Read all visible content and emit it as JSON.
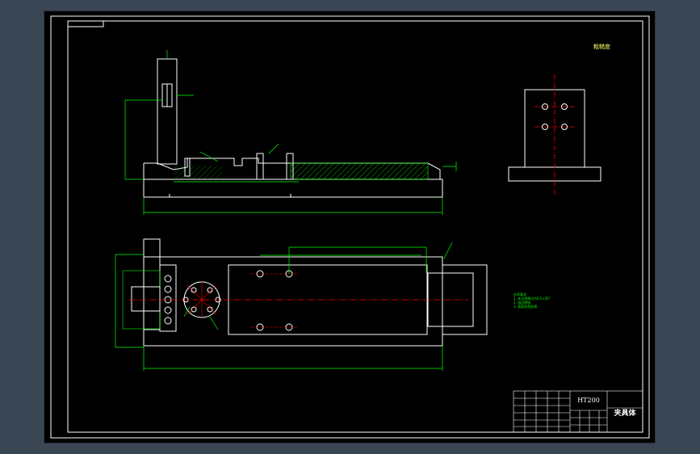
{
  "drawing": {
    "corner_note": "粗糙度",
    "tech_requirements": {
      "title": "技术要求",
      "lines": [
        "1. 未注倒角均为0.5×45°",
        "2. 锐边倒钝",
        "3. 表面发黑处理"
      ]
    },
    "title_block": {
      "material": "HT200",
      "name": "夹具体"
    }
  },
  "colors": {
    "background": "#000000",
    "outline": "#ffffff",
    "dimension": "#00ff00",
    "centerline": "#ff0000",
    "hatch": "#00ff00",
    "frame_accent": "#00c0ff"
  }
}
